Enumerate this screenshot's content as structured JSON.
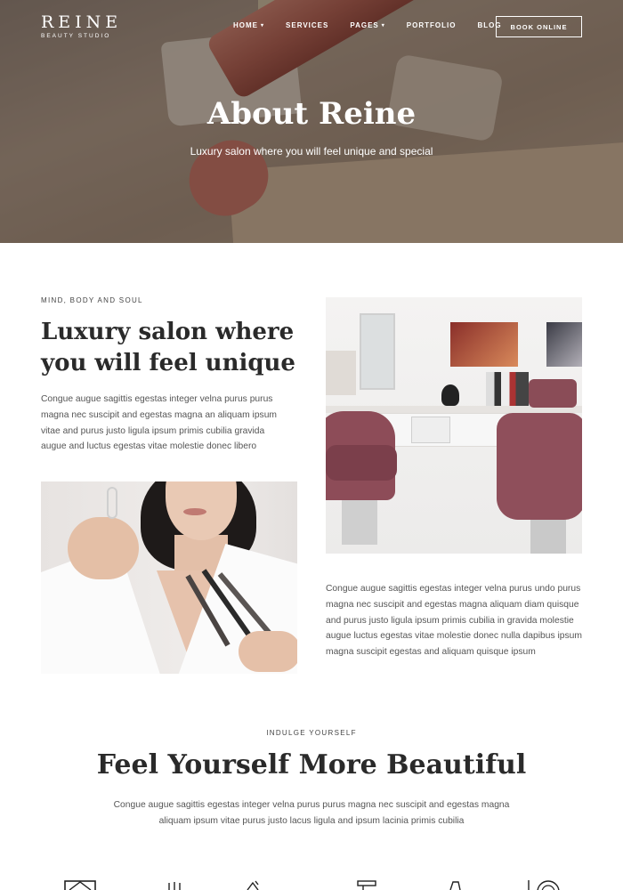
{
  "brand": {
    "name": "REINE",
    "tagline": "BEAUTY STUDIO"
  },
  "nav": {
    "items": [
      {
        "label": "HOME",
        "has_dropdown": true
      },
      {
        "label": "SERVICES",
        "has_dropdown": false
      },
      {
        "label": "PAGES",
        "has_dropdown": true
      },
      {
        "label": "PORTFOLIO",
        "has_dropdown": false
      },
      {
        "label": "BLOG",
        "has_dropdown": false
      }
    ],
    "cta": "BOOK ONLINE"
  },
  "hero": {
    "title": "About Reine",
    "subtitle": "Luxury salon where you will feel unique and special"
  },
  "about": {
    "eyebrow": "MIND, BODY AND SOUL",
    "heading": "Luxury salon where you will feel unique",
    "paragraph1": "Congue augue sagittis egestas integer velna purus purus magna nec suscipit and egestas magna an aliquam ipsum vitae and purus justo ligula ipsum primis cubilia gravida augue and luctus egestas vitae molestie donec libero",
    "paragraph2": "Congue augue sagittis egestas integer velna purus undo purus magna nec suscipit and egestas magna aliquam diam quisque and purus justo ligula ipsum primis cubilia in gravida molestie augue luctus egestas vitae molestie donec nulla dapibus ipsum magna suscipit egestas and aliquam quisque ipsum"
  },
  "feel": {
    "eyebrow": "INDULGE YOURSELF",
    "heading": "Feel Yourself More Beautiful",
    "paragraph": "Congue augue sagittis egestas integer velna purus purus magna nec suscipit and egestas magna aliquam ipsum vitae purus justo lacus ligula and ipsum lacinia primis cubilia"
  },
  "icons": [
    "picture-frame-icon",
    "hand-icon",
    "scissors-icon",
    "hair-dryer-icon",
    "nail-polish-icon",
    "mirror-icon"
  ],
  "colors": {
    "accent": "#2a2a2a",
    "hero_overlay": "#281c16",
    "chair": "#8d4c58"
  }
}
